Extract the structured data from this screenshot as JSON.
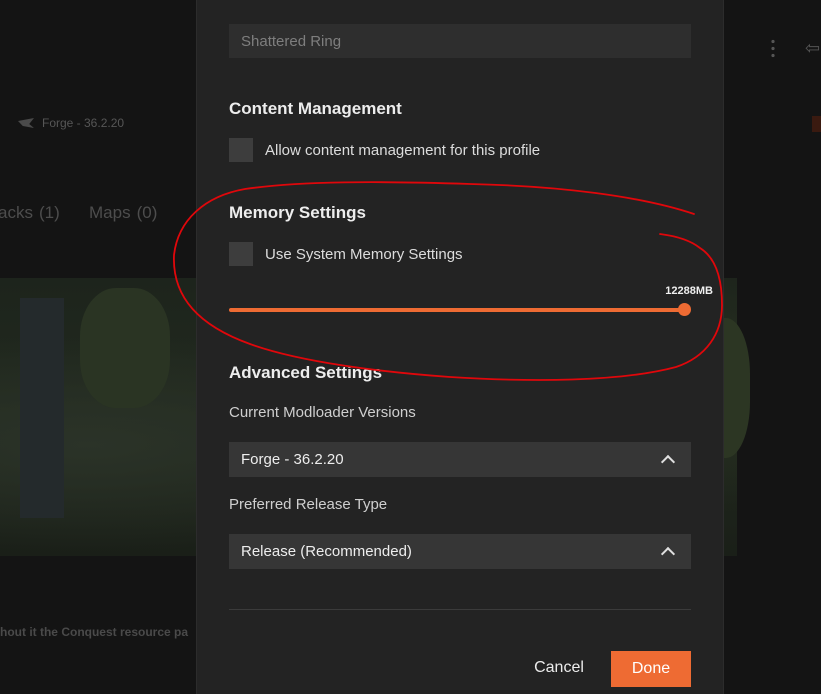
{
  "background": {
    "loader_text": "Forge - 36.2.20",
    "tabs": [
      {
        "label": "acks",
        "count": "(1)"
      },
      {
        "label": "Maps",
        "count": "(0)"
      }
    ],
    "description": "hout it the Conquest resource pa"
  },
  "modal": {
    "name_input_value": "Shattered Ring",
    "content_management": {
      "title": "Content Management",
      "checkbox_label": "Allow content management for this profile",
      "checked": false
    },
    "memory_settings": {
      "title": "Memory Settings",
      "checkbox_label": "Use System Memory Settings",
      "checked": false,
      "slider_value_label": "12288MB",
      "slider_fraction": 1.0
    },
    "advanced_settings": {
      "title": "Advanced Settings",
      "modloader_label": "Current Modloader Versions",
      "modloader_value": "Forge - 36.2.20",
      "release_label": "Preferred Release Type",
      "release_value": "Release (Recommended)"
    },
    "buttons": {
      "cancel": "Cancel",
      "done": "Done"
    }
  },
  "colors": {
    "accent": "#ee6b33",
    "annotation": "#e0070b"
  },
  "icons": {
    "loader": "forge-anvil-icon",
    "chevron": "chevron-up-icon",
    "menu": "kebab-menu-icon",
    "back": "back-arrow-icon"
  }
}
